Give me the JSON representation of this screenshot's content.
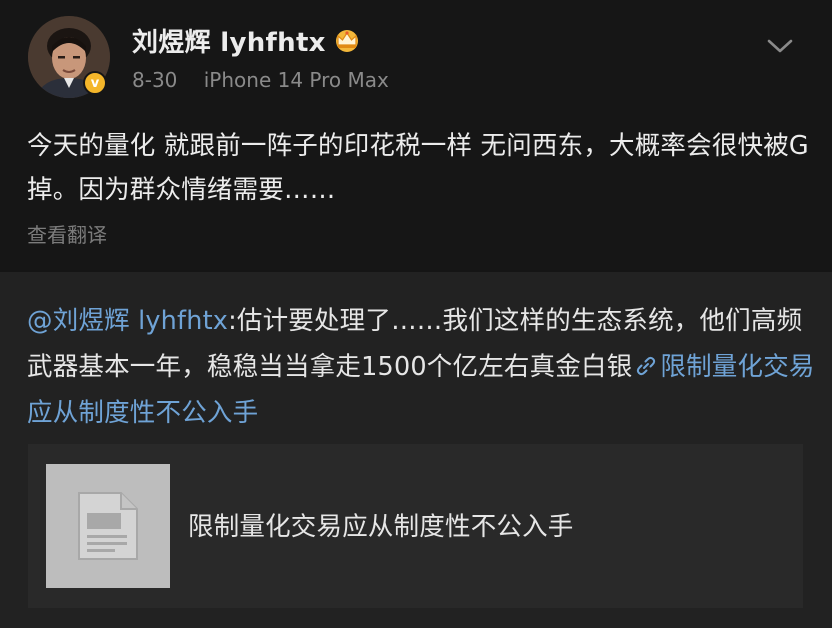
{
  "post": {
    "username": "刘煜辉 lyhfhtx",
    "crown_icon": "crown-icon",
    "verified_icon": "verified-v-icon",
    "verified_letter": "v",
    "date": "8-30",
    "device": "iPhone 14 Pro Max",
    "content": "今天的量化 就跟前一阵子的印花税一样 无问西东，大概率会很快被G掉。因为群众情绪需要……",
    "translate_label": "查看翻译"
  },
  "repost": {
    "mention": "@刘煜辉 lyhfhtx",
    "text": ":估计要处理了……我们这样的生态系统，他们高频武器基本一年，稳稳当当拿走1500个亿左右真金白银",
    "link_text": "限制量化交易应从制度性不公入手",
    "card": {
      "title": "限制量化交易应从制度性不公入手",
      "thumb_icon": "document-placeholder-icon"
    }
  },
  "colors": {
    "background": "#161616",
    "repost_background": "#222222",
    "card_background": "#292929",
    "link": "#6fa3d6",
    "verified_badge": "#f4b62a",
    "meta_text": "#8a8a8a"
  }
}
